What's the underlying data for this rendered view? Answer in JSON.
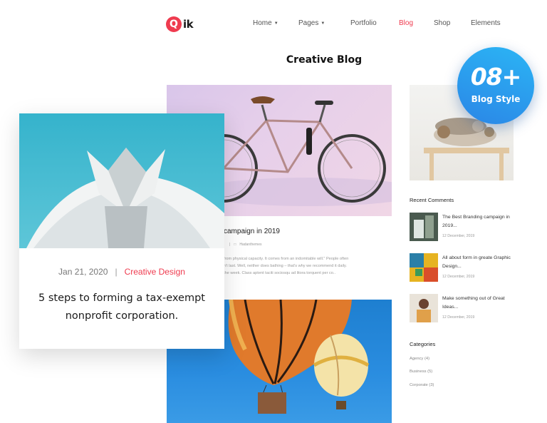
{
  "brand": {
    "logo_letter": "Q",
    "logo_rest": "ik",
    "accent": "#ef3b4f"
  },
  "nav": {
    "items": [
      {
        "label": "Home",
        "dropdown": true
      },
      {
        "label": "Pages",
        "dropdown": true
      },
      {
        "label": "Portfolio",
        "dropdown": false
      },
      {
        "label": "Blog",
        "dropdown": false,
        "active": true
      },
      {
        "label": "Shop",
        "dropdown": false
      },
      {
        "label": "Elements",
        "dropdown": false
      }
    ]
  },
  "page": {
    "title": "Creative Blog"
  },
  "badge": {
    "number": "08+",
    "label": "Blog Style",
    "color": "#2b9ef0"
  },
  "featured_card": {
    "date": "Jan 21, 2020",
    "separator": "|",
    "category": "Creative Design",
    "title": "5 steps to forming a tax-exempt nonprofit corporation."
  },
  "post_1": {
    "title_visible": "campaign in 2019",
    "meta_sep": "|",
    "author": "Hadanthemes",
    "excerpt_lines": [
      "from physical capacity. It comes from an indomitable will.\" People often",
      "n't last. Well, neither does bathing – that's why we recommend it daily.",
      "the week. Class aptent taciti sociosqu ad litora torquent per co.."
    ]
  },
  "sidebar": {
    "recent_comments_heading": "Recent Comments",
    "comments": [
      {
        "title": "The Best Branding campaign in 2019...",
        "date": "12 December, 2019"
      },
      {
        "title": "All about form in greate Graphic Design...",
        "date": "12 December, 2019"
      },
      {
        "title": "Make something out of Great Ideas...",
        "date": "12 December, 2019"
      }
    ],
    "categories_heading": "Categories",
    "categories": [
      "Agency (4)",
      "Business (5)",
      "Corporate (3)"
    ]
  }
}
